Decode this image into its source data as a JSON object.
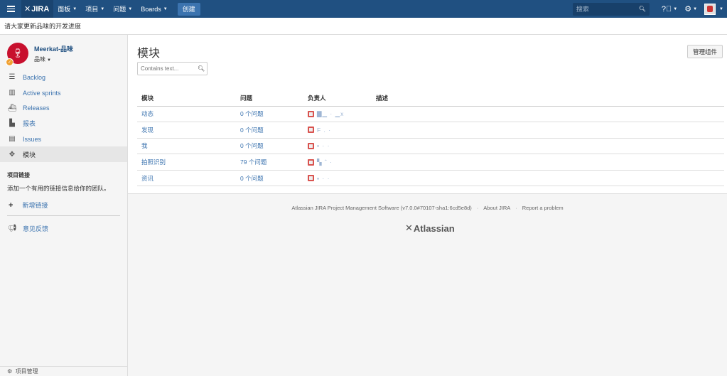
{
  "topnav": {
    "logo": "JIRA",
    "items": [
      "面板",
      "项目",
      "问题",
      "Boards"
    ],
    "create_label": "创建",
    "search_placeholder": "搜索",
    "help_icon": "question-icon",
    "settings_icon": "gear-icon"
  },
  "announcement": "请大家更新品味的开发进度",
  "sidebar": {
    "project_name": "Meerkat-品味",
    "project_type": "品味",
    "nav": [
      {
        "label": "Backlog",
        "icon": "backlog-icon"
      },
      {
        "label": "Active sprints",
        "icon": "board-icon"
      },
      {
        "label": "Releases",
        "icon": "ship-icon"
      },
      {
        "label": "报表",
        "icon": "chart-icon"
      },
      {
        "label": "Issues",
        "icon": "issues-icon"
      },
      {
        "label": "模块",
        "icon": "puzzle-icon",
        "active": true
      }
    ],
    "links_title": "项目链接",
    "links_text": "添加一个有用的链接信息给你的团队。",
    "add_link_label": "新增链接",
    "feedback_label": "意见反馈",
    "bottom_label": "项目管理"
  },
  "main": {
    "title": "模块",
    "manage_label": "管理组件",
    "filter_placeholder": "Contains text...",
    "columns": [
      "模块",
      "问题",
      "负责人",
      "描述"
    ],
    "rows": [
      {
        "name": "动态",
        "issues": "0 个问题",
        "lead": "▇▁ · ▁x",
        "desc": ""
      },
      {
        "name": "发现",
        "issues": "0 个问题",
        "lead": "F . ·",
        "desc": ""
      },
      {
        "name": "我",
        "issues": "0 个问题",
        "lead": "▪ · ·",
        "desc": ""
      },
      {
        "name": "拍照识别",
        "issues": "79 个问题",
        "lead": "▚ ˆ ·",
        "desc": ""
      },
      {
        "name": "资讯",
        "issues": "0 个问题",
        "lead": "▪ · ·",
        "desc": ""
      }
    ]
  },
  "footer": {
    "version": "Atlassian JIRA Project Management Software (v7.0.0#70107-sha1:6cd5e8d)",
    "about": "About JIRA",
    "report": "Report a problem",
    "brand": "Atlassian"
  }
}
